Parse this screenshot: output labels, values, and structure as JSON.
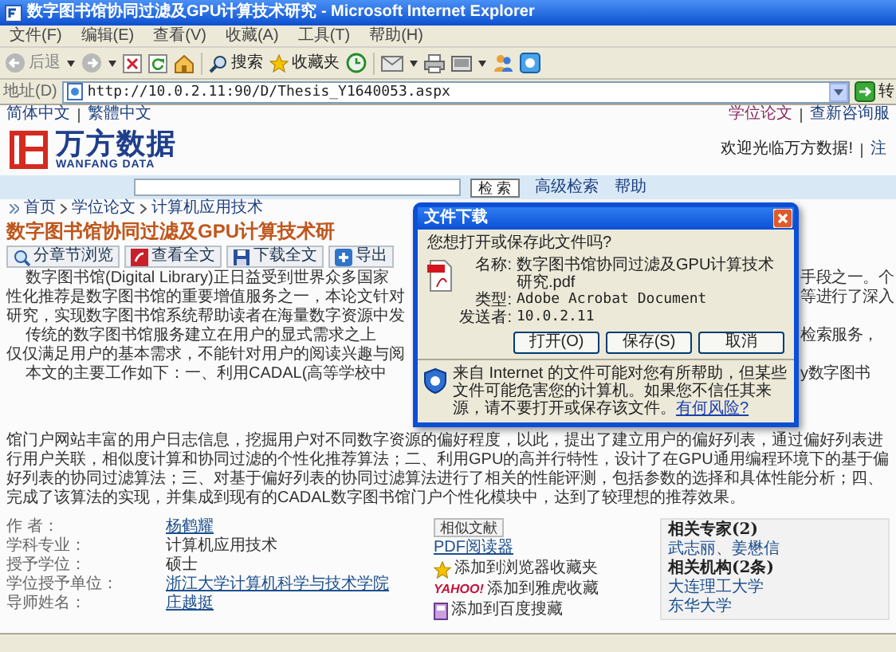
{
  "window": {
    "title": "数字图书馆协同过滤及GPU计算技术研究 - Microsoft Internet Explorer"
  },
  "menu": [
    "文件(F)",
    "编辑(E)",
    "查看(V)",
    "收藏(A)",
    "工具(T)",
    "帮助(H)"
  ],
  "toolbar": {
    "back": "后退",
    "search": "搜索",
    "favorites": "收藏夹"
  },
  "address_bar": {
    "label": "地址(D)",
    "url": "http://10.0.2.11:90/D/Thesis_Y1640053.aspx",
    "go": "转"
  },
  "site_header": {
    "languages": [
      {
        "label": "简体中文"
      },
      {
        "label": "繁體中文"
      }
    ],
    "top_links": [
      {
        "label": "学位论文",
        "selected": true
      },
      {
        "label": "查新咨询服",
        "selected": false
      }
    ],
    "logo": {
      "name": "万方数据",
      "subtitle": "WANFANG DATA"
    },
    "welcome": "欢迎光临万方数据!",
    "user_link": "注"
  },
  "search": {
    "button": "检 索",
    "links": [
      "高级检索",
      "帮助"
    ]
  },
  "breadcrumb": [
    "首页",
    "学位论文",
    "计算机应用技术"
  ],
  "title": "数字图书馆协同过滤及GPU计算技术研",
  "actions": [
    {
      "kind": "browse",
      "label": "分章节浏览"
    },
    {
      "kind": "view",
      "label": "查看全文"
    },
    {
      "kind": "download",
      "label": "下载全文"
    },
    {
      "kind": "export",
      "label": "导出"
    }
  ],
  "abstract_lines": [
    {
      "left": "数字图书馆(Digital Library)正日益受到世界众多国家",
      "right": "手段之一。个",
      "paragraph_start": true
    },
    {
      "left": "性化推荐是数字图书馆的重要增值服务之一，本论文针对",
      "right": "等进行了深入",
      "paragraph_start": false
    },
    {
      "left": "研究，实现数字图书馆系统帮助读者在海量数字资源中发",
      "paragraph_start": false
    },
    {
      "left": "传统的数字图书馆服务建立在用户的显式需求之上",
      "right": "检索服务，",
      "paragraph_start": true
    },
    {
      "left": "仅仅满足用户的基本需求，不能针对用户的阅读兴趣与阅",
      "paragraph_start": false
    },
    {
      "left": "本文的主要工作如下：一、利用CADAL(高等学校中",
      "right": "y数字图书",
      "paragraph_start": true
    }
  ],
  "abstract_tail": "馆门户网站丰富的用户日志信息，挖掘用户对不同数字资源的偏好程度，以此，提出了建立用户的偏好列表，通过偏好列表进行用户关联，相似度计算和协同过滤的个性化推荐算法；二、利用GPU的高并行特性，设计了在GPU通用编程环境下的基于偏好列表的协同过滤算法；三、对基于偏好列表的协同过滤算法进行了相关的性能评测，包括参数的选择和具体性能分析；四、完成了该算法的实现，并集成到现有的CADAL数字图书馆门户个性化模块中，达到了较理想的推荐效果。",
  "meta": [
    {
      "label": "作 者：",
      "value": "杨鹤耀",
      "link": true
    },
    {
      "label": "学科专业：",
      "value": "计算机应用技术",
      "link": false
    },
    {
      "label": "授予学位：",
      "value": "硕士",
      "link": false
    },
    {
      "label": "学位授予单位：",
      "value": "浙江大学计算机科学与技术学院",
      "link": true
    },
    {
      "label": "导师姓名：",
      "value": "庄越挺",
      "link": true
    }
  ],
  "similar_button": "相似文献",
  "pdf_link": "PDF阅读器",
  "share_links": [
    {
      "kind": "favorites",
      "label": "添加到浏览器收藏夹"
    },
    {
      "kind": "yahoo",
      "logo_text": "YAHOO!",
      "label": "添加到雅虎收藏"
    },
    {
      "kind": "baidu",
      "label": "添加到百度搜藏"
    }
  ],
  "related": {
    "experts_heading": "相关专家(2)",
    "experts": [
      "武志丽",
      "姜懋信"
    ],
    "separator": "、",
    "orgs_heading": "相关机构(2条)",
    "orgs": [
      "大连理工大学",
      "东华大学"
    ]
  },
  "dialog": {
    "title": "文件下载",
    "question": "您想打开或保存此文件吗?",
    "fields": [
      {
        "label": "名称:",
        "value": "数字图书馆协同过滤及GPU计算技术研究.pdf"
      },
      {
        "label": "类型:",
        "value": "Adobe Acrobat Document"
      },
      {
        "label": "发送者:",
        "value": "10.0.2.11"
      }
    ],
    "buttons": [
      "打开(O)",
      "保存(S)",
      "取消"
    ],
    "warning": "来自 Internet 的文件可能对您有所帮助，但某些文件可能危害您的计算机。如果您不信任其来源，请不要打开或保存该文件。",
    "risk_link": "有何风险?"
  }
}
